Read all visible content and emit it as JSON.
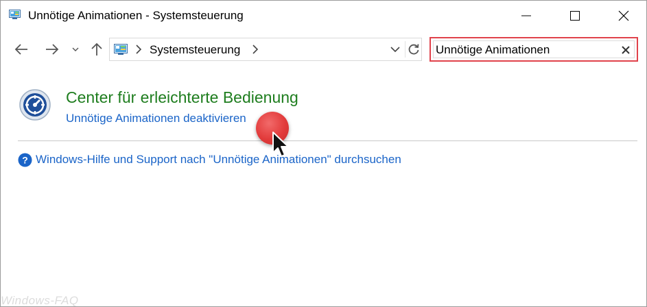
{
  "window": {
    "title": "Unnötige Animationen - Systemsteuerung",
    "icon": "control-panel-icon"
  },
  "nav": {
    "back_icon": "arrow-left-icon",
    "forward_icon": "arrow-right-icon",
    "recent_icon": "chevron-down-icon",
    "up_icon": "arrow-up-icon"
  },
  "address": {
    "crumb": "Systemsteuerung",
    "icon": "control-panel-icon"
  },
  "search": {
    "value": "Unnötige Animationen",
    "highlight_color": "#e0414a"
  },
  "result": {
    "title": "Center für erleichterte Bedienung",
    "link": "Unnötige Animationen deaktivieren",
    "title_color": "#1e7d1e",
    "link_color": "#1a64c8"
  },
  "help": {
    "link": "Windows-Hilfe und Support nach \"Unnötige Animationen\" durchsuchen"
  },
  "watermark": "Windows-FAQ"
}
